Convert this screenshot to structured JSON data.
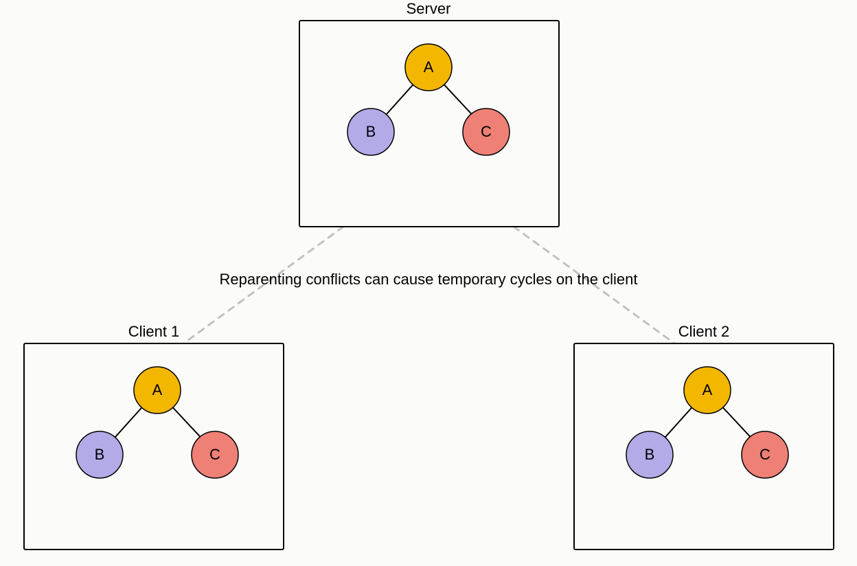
{
  "chart_data": {
    "type": "tree",
    "caption": "Reparenting conflicts can cause temporary cycles on the client",
    "colors": {
      "A": "#f3b700",
      "B": "#b3abe8",
      "C": "#ef8076",
      "stroke": "#000000",
      "box_stroke": "#000000",
      "dash": "#c1c1c1",
      "bg": "#fbfbfa"
    },
    "panels": [
      {
        "id": "server",
        "title": "Server",
        "nodes": [
          {
            "id": "A",
            "label": "A",
            "color": "#f3b700"
          },
          {
            "id": "B",
            "label": "B",
            "color": "#b3abe8"
          },
          {
            "id": "C",
            "label": "C",
            "color": "#ef8076"
          }
        ],
        "edges": [
          {
            "from": "A",
            "to": "B"
          },
          {
            "from": "A",
            "to": "C"
          }
        ]
      },
      {
        "id": "client1",
        "title": "Client 1",
        "nodes": [
          {
            "id": "A",
            "label": "A",
            "color": "#f3b700"
          },
          {
            "id": "B",
            "label": "B",
            "color": "#b3abe8"
          },
          {
            "id": "C",
            "label": "C",
            "color": "#ef8076"
          }
        ],
        "edges": [
          {
            "from": "A",
            "to": "B"
          },
          {
            "from": "A",
            "to": "C"
          }
        ]
      },
      {
        "id": "client2",
        "title": "Client 2",
        "nodes": [
          {
            "id": "A",
            "label": "A",
            "color": "#f3b700"
          },
          {
            "id": "B",
            "label": "B",
            "color": "#b3abe8"
          },
          {
            "id": "C",
            "label": "C",
            "color": "#ef8076"
          }
        ],
        "edges": [
          {
            "from": "A",
            "to": "B"
          },
          {
            "from": "A",
            "to": "C"
          }
        ]
      }
    ],
    "connections": [
      {
        "from_panel": "server",
        "to_panel": "client1",
        "style": "dashed"
      },
      {
        "from_panel": "server",
        "to_panel": "client2",
        "style": "dashed"
      }
    ]
  }
}
